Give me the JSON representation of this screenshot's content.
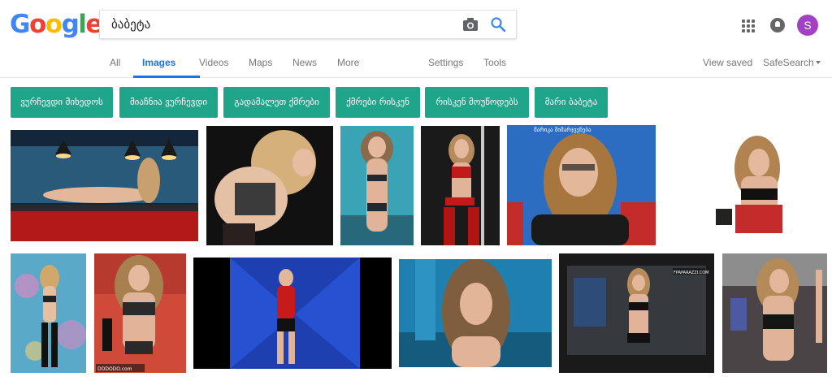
{
  "logo": {
    "letters": [
      "G",
      "o",
      "o",
      "g",
      "l",
      "e"
    ],
    "colors": [
      "#4285f4",
      "#ea4335",
      "#fbbc05",
      "#4285f4",
      "#34a853",
      "#ea4335"
    ]
  },
  "search": {
    "query": "ბაბეტა"
  },
  "account": {
    "initial": "S",
    "avatar_color": "#a142c4"
  },
  "nav": {
    "all": "All",
    "images": "Images",
    "videos": "Videos",
    "maps": "Maps",
    "news": "News",
    "more": "More",
    "settings": "Settings",
    "tools": "Tools",
    "view_saved": "View saved",
    "safesearch": "SafeSearch"
  },
  "chips": [
    "ვურჩევდი მიხედოს",
    "მიაჩნია ვურჩევდი",
    "გადამალეთ ქმრები",
    "ქმრები რისკენ",
    "რისკენ მოუწოდებს",
    "მარი ბაბეტა"
  ],
  "image_overlays": {
    "tv_caption": "მარიკა მიმარჯვენება",
    "watermark_dodo": "DODODO.com",
    "watermark_paparazzi": "FPAPARAZZI.COM"
  },
  "colors": {
    "accent": "#1a73e8",
    "chip": "#1fa58a"
  }
}
